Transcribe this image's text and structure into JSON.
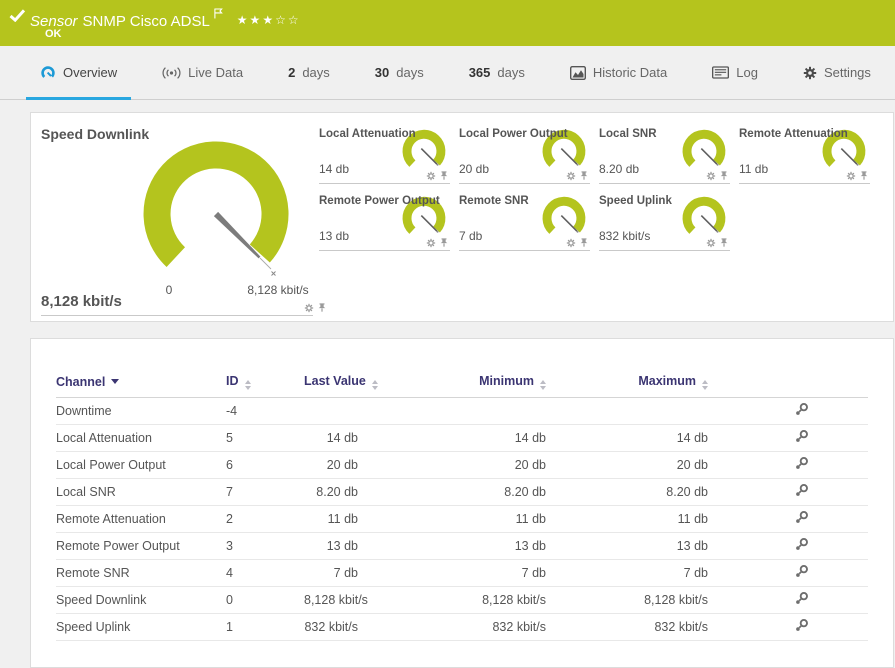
{
  "topbar": {
    "prefix": "Sensor",
    "title": "SNMP Cisco ADSL",
    "status": "OK",
    "stars_filled": "★★★",
    "stars_empty": "☆☆",
    "color": "#b5c41d"
  },
  "tabs": [
    {
      "label": "Overview",
      "icon": "gauge-icon",
      "active": true
    },
    {
      "label": "Live Data",
      "icon": "broadcast-icon"
    },
    {
      "num": "2",
      "label": "days"
    },
    {
      "num": "30",
      "label": "days"
    },
    {
      "num": "365",
      "label": "days"
    },
    {
      "label": "Historic Data",
      "icon": "area-chart-icon"
    },
    {
      "label": "Log",
      "icon": "log-icon"
    },
    {
      "label": "Settings",
      "icon": "gear-icon"
    }
  ],
  "gauges": {
    "accent_color": "#b4c41e",
    "main": {
      "title": "Speed Downlink",
      "value": "8,128 kbit/s",
      "scale_min": "0",
      "scale_max": "8,128 kbit/s"
    },
    "minis": [
      {
        "title": "Local Attenuation",
        "value": "14 db"
      },
      {
        "title": "Local Power Output",
        "value": "20 db"
      },
      {
        "title": "Local SNR",
        "value": "8.20 db"
      },
      {
        "title": "Remote Attenuation",
        "value": "11 db"
      },
      {
        "title": "Remote Power Output",
        "value": "13 db"
      },
      {
        "title": "Remote SNR",
        "value": "7 db"
      },
      {
        "title": "Speed Uplink",
        "value": "832 kbit/s"
      }
    ]
  },
  "table": {
    "headers": {
      "channel": "Channel",
      "id": "ID",
      "last": "Last Value",
      "min": "Minimum",
      "max": "Maximum"
    },
    "rows": [
      {
        "channel": "Downtime",
        "id": "-4",
        "last": "",
        "min": "",
        "max": ""
      },
      {
        "channel": "Local Attenuation",
        "id": "5",
        "last": "14 db",
        "min": "14 db",
        "max": "14 db"
      },
      {
        "channel": "Local Power Output",
        "id": "6",
        "last": "20 db",
        "min": "20 db",
        "max": "20 db"
      },
      {
        "channel": "Local SNR",
        "id": "7",
        "last": "8.20 db",
        "min": "8.20 db",
        "max": "8.20 db"
      },
      {
        "channel": "Remote Attenuation",
        "id": "2",
        "last": "11 db",
        "min": "11 db",
        "max": "11 db"
      },
      {
        "channel": "Remote Power Output",
        "id": "3",
        "last": "13 db",
        "min": "13 db",
        "max": "13 db"
      },
      {
        "channel": "Remote SNR",
        "id": "4",
        "last": "7 db",
        "min": "7 db",
        "max": "7 db"
      },
      {
        "channel": "Speed Downlink",
        "id": "0",
        "last": "8,128 kbit/s",
        "min": "8,128 kbit/s",
        "max": "8,128 kbit/s"
      },
      {
        "channel": "Speed Uplink",
        "id": "1",
        "last": "832 kbit/s",
        "min": "832 kbit/s",
        "max": "832 kbit/s"
      }
    ]
  }
}
